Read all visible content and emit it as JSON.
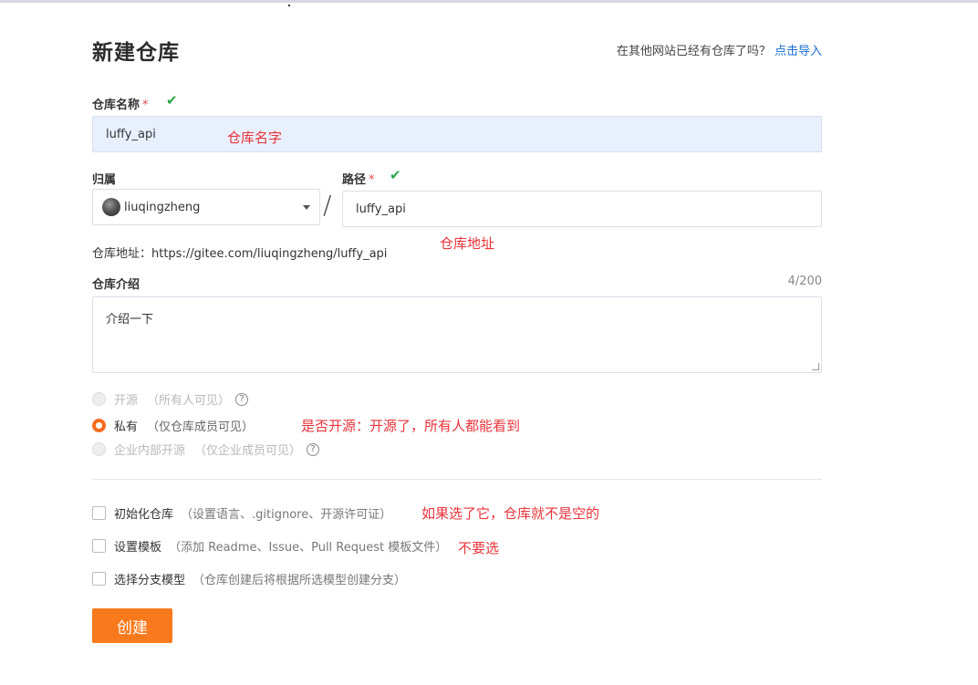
{
  "page": {
    "title": "新建仓库",
    "import_prompt": "在其他网站已经有仓库了吗？",
    "import_link": "点击导入"
  },
  "repo_name": {
    "label": "仓库名称",
    "required_mark": "*",
    "value": "luffy_api",
    "annotation": "仓库名字"
  },
  "owner": {
    "label": "归属",
    "value": "liuqingzheng"
  },
  "path": {
    "label": "路径",
    "required_mark": "*",
    "value": "luffy_api",
    "separator": "/",
    "annotation": "仓库地址"
  },
  "repo_url": {
    "text": "仓库地址：https://gitee.com/liuqingzheng/luffy_api"
  },
  "description": {
    "label": "仓库介绍",
    "counter": "4/200",
    "value": "介绍一下"
  },
  "visibility": {
    "options": [
      {
        "label": "开源",
        "sub": "（所有人可见）",
        "checked": false,
        "disabled": true,
        "help": true
      },
      {
        "label": "私有",
        "sub": "（仅仓库成员可见）",
        "checked": true,
        "disabled": false,
        "help": false
      },
      {
        "label": "企业内部开源",
        "sub": "（仅企业成员可见）",
        "checked": false,
        "disabled": true,
        "help": true
      }
    ],
    "annotation": "是否开源：开源了，所有人都能看到"
  },
  "options": {
    "items": [
      {
        "label": "初始化仓库",
        "sub": "（设置语言、.gitignore、开源许可证）",
        "checked": false
      },
      {
        "label": "设置模板",
        "sub": "（添加 Readme、Issue、Pull Request 模板文件）",
        "checked": false
      },
      {
        "label": "选择分支模型",
        "sub": "（仓库创建后将根据所选模型创建分支）",
        "checked": false
      }
    ],
    "annotation_init": "如果选了它，仓库就不是空的",
    "annotation_template": "不要选"
  },
  "submit": {
    "label": "创建"
  },
  "colors": {
    "accent": "#f87a1d",
    "annotation": "#e8333a",
    "check": "#2ba84a",
    "link": "#1a6fd1"
  },
  "icons": {
    "valid": "check-icon",
    "help": "question-circle-icon",
    "dropdown": "caret-down-icon"
  }
}
